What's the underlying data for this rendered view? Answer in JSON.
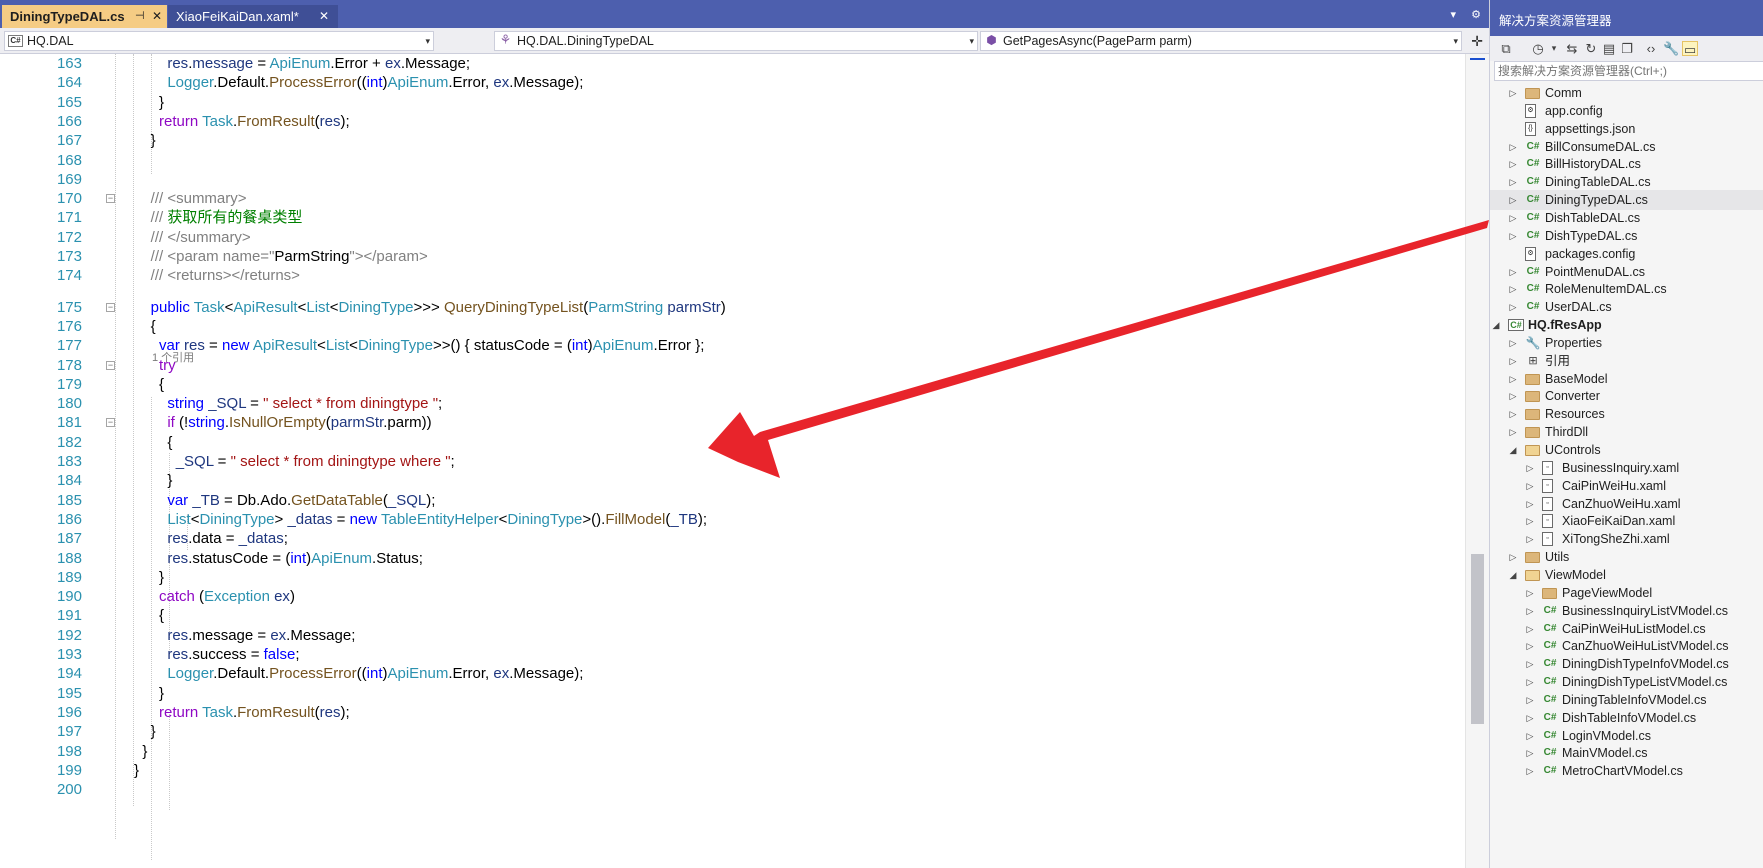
{
  "tabs": [
    {
      "label": "DiningTypeDAL.cs",
      "pin": "⊣",
      "close": "✕",
      "active": true
    },
    {
      "label": "XiaoFeiKaiDan.xaml*",
      "close": "✕",
      "active": false
    }
  ],
  "tabbar_controls": "▾ ⚙",
  "navbar": {
    "project": "HQ.DAL",
    "project_icon": "C#",
    "type": "HQ.DAL.DiningTypeDAL",
    "member": "GetPagesAsync(PageParm parm)",
    "arrow": "▾",
    "split": "✛"
  },
  "editor": {
    "codelens": "1 个引用",
    "lines": [
      {
        "n": "163",
        "tokens": [
          [
            "pl",
            "        "
          ],
          [
            "var",
            "res"
          ],
          [
            "pl",
            "."
          ],
          [
            "var",
            "message"
          ],
          [
            "pl",
            " = "
          ],
          [
            "ty",
            "ApiEnum"
          ],
          [
            "pl",
            ".Error + "
          ],
          [
            "var",
            "ex"
          ],
          [
            "pl",
            ".Message;"
          ]
        ]
      },
      {
        "n": "164",
        "tokens": [
          [
            "pl",
            "        "
          ],
          [
            "ty",
            "Logger"
          ],
          [
            "pl",
            ".Default."
          ],
          [
            "fn",
            "ProcessError"
          ],
          [
            "pl",
            "(("
          ],
          [
            "kw",
            "int"
          ],
          [
            "pl",
            ")"
          ],
          [
            "ty",
            "ApiEnum"
          ],
          [
            "pl",
            ".Error, "
          ],
          [
            "var",
            "ex"
          ],
          [
            "pl",
            ".Message);"
          ]
        ]
      },
      {
        "n": "165",
        "tokens": [
          [
            "pl",
            "      }"
          ]
        ]
      },
      {
        "n": "166",
        "tokens": [
          [
            "pl",
            "      "
          ],
          [
            "ctl",
            "return"
          ],
          [
            "pl",
            " "
          ],
          [
            "ty",
            "Task"
          ],
          [
            "pl",
            "."
          ],
          [
            "fn",
            "FromResult"
          ],
          [
            "pl",
            "("
          ],
          [
            "var",
            "res"
          ],
          [
            "pl",
            ");"
          ]
        ]
      },
      {
        "n": "167",
        "tokens": [
          [
            "pl",
            "    }"
          ]
        ]
      },
      {
        "n": "168",
        "tokens": []
      },
      {
        "n": "169",
        "tokens": []
      },
      {
        "n": "170",
        "tokens": [
          [
            "doc",
            "    /// <summary>"
          ]
        ]
      },
      {
        "n": "171",
        "tokens": [
          [
            "doc",
            "    /// "
          ],
          [
            "cm",
            "获取所有的餐桌类型"
          ]
        ]
      },
      {
        "n": "172",
        "tokens": [
          [
            "doc",
            "    /// </summary>"
          ]
        ]
      },
      {
        "n": "173",
        "tokens": [
          [
            "doc",
            "    /// <param name=\""
          ],
          [
            "pl",
            "ParmString"
          ],
          [
            "doc",
            "\"></param>"
          ]
        ]
      },
      {
        "n": "174",
        "tokens": [
          [
            "doc",
            "    /// <returns></returns>"
          ]
        ]
      },
      {
        "n": "175",
        "tokens": [
          [
            "pl",
            "    "
          ],
          [
            "kw",
            "public"
          ],
          [
            "pl",
            " "
          ],
          [
            "ty",
            "Task"
          ],
          [
            "pl",
            "<"
          ],
          [
            "ty",
            "ApiResult"
          ],
          [
            "pl",
            "<"
          ],
          [
            "ty",
            "List"
          ],
          [
            "pl",
            "<"
          ],
          [
            "ty",
            "DiningType"
          ],
          [
            "pl",
            ">>> "
          ],
          [
            "fn",
            "QueryDiningTypeList"
          ],
          [
            "pl",
            "("
          ],
          [
            "ty",
            "ParmString"
          ],
          [
            "pl",
            " "
          ],
          [
            "var",
            "parmStr"
          ],
          [
            "pl",
            ")"
          ]
        ]
      },
      {
        "n": "176",
        "tokens": [
          [
            "pl",
            "    {"
          ]
        ]
      },
      {
        "n": "177",
        "tokens": [
          [
            "pl",
            "      "
          ],
          [
            "kw",
            "var"
          ],
          [
            "pl",
            " "
          ],
          [
            "var",
            "res"
          ],
          [
            "pl",
            " = "
          ],
          [
            "kw",
            "new"
          ],
          [
            "pl",
            " "
          ],
          [
            "ty",
            "ApiResult"
          ],
          [
            "pl",
            "<"
          ],
          [
            "ty",
            "List"
          ],
          [
            "pl",
            "<"
          ],
          [
            "ty",
            "DiningType"
          ],
          [
            "pl",
            ">>() { statusCode = ("
          ],
          [
            "kw",
            "int"
          ],
          [
            "pl",
            ")"
          ],
          [
            "ty",
            "ApiEnum"
          ],
          [
            "pl",
            ".Error };"
          ]
        ]
      },
      {
        "n": "178",
        "tokens": [
          [
            "pl",
            "      "
          ],
          [
            "ctl",
            "try"
          ]
        ]
      },
      {
        "n": "179",
        "tokens": [
          [
            "pl",
            "      {"
          ]
        ]
      },
      {
        "n": "180",
        "tokens": [
          [
            "pl",
            "        "
          ],
          [
            "kw",
            "string"
          ],
          [
            "pl",
            " "
          ],
          [
            "var",
            "_SQL"
          ],
          [
            "pl",
            " = "
          ],
          [
            "str",
            "\" select * from diningtype \""
          ],
          [
            "pl",
            ";"
          ]
        ]
      },
      {
        "n": "181",
        "tokens": [
          [
            "pl",
            "        "
          ],
          [
            "ctl",
            "if"
          ],
          [
            "pl",
            " (!"
          ],
          [
            "kw",
            "string"
          ],
          [
            "pl",
            "."
          ],
          [
            "fn",
            "IsNullOrEmpty"
          ],
          [
            "pl",
            "("
          ],
          [
            "var",
            "parmStr"
          ],
          [
            "pl",
            ".parm))"
          ]
        ]
      },
      {
        "n": "182",
        "tokens": [
          [
            "pl",
            "        {"
          ]
        ]
      },
      {
        "n": "183",
        "tokens": [
          [
            "pl",
            "          "
          ],
          [
            "var",
            "_SQL"
          ],
          [
            "pl",
            " = "
          ],
          [
            "str",
            "\" select * from diningtype where \""
          ],
          [
            "pl",
            ";"
          ]
        ]
      },
      {
        "n": "184",
        "tokens": [
          [
            "pl",
            "        }"
          ]
        ]
      },
      {
        "n": "185",
        "tokens": [
          [
            "pl",
            "        "
          ],
          [
            "kw",
            "var"
          ],
          [
            "pl",
            " "
          ],
          [
            "var",
            "_TB"
          ],
          [
            "pl",
            " = Db.Ado."
          ],
          [
            "fn",
            "GetDataTable"
          ],
          [
            "pl",
            "("
          ],
          [
            "var",
            "_SQL"
          ],
          [
            "pl",
            ");"
          ]
        ]
      },
      {
        "n": "186",
        "tokens": [
          [
            "pl",
            "        "
          ],
          [
            "ty",
            "List"
          ],
          [
            "pl",
            "<"
          ],
          [
            "ty",
            "DiningType"
          ],
          [
            "pl",
            "> "
          ],
          [
            "var",
            "_datas"
          ],
          [
            "pl",
            " = "
          ],
          [
            "kw",
            "new"
          ],
          [
            "pl",
            " "
          ],
          [
            "ty",
            "TableEntityHelper"
          ],
          [
            "pl",
            "<"
          ],
          [
            "ty",
            "DiningType"
          ],
          [
            "pl",
            ">()."
          ],
          [
            "fn",
            "FillModel"
          ],
          [
            "pl",
            "("
          ],
          [
            "var",
            "_TB"
          ],
          [
            "pl",
            ");"
          ]
        ]
      },
      {
        "n": "187",
        "tokens": [
          [
            "pl",
            "        "
          ],
          [
            "var",
            "res"
          ],
          [
            "pl",
            ".data = "
          ],
          [
            "var",
            "_datas"
          ],
          [
            "pl",
            ";"
          ]
        ]
      },
      {
        "n": "188",
        "tokens": [
          [
            "pl",
            "        "
          ],
          [
            "var",
            "res"
          ],
          [
            "pl",
            ".statusCode = ("
          ],
          [
            "kw",
            "int"
          ],
          [
            "pl",
            ")"
          ],
          [
            "ty",
            "ApiEnum"
          ],
          [
            "pl",
            ".Status;"
          ]
        ]
      },
      {
        "n": "189",
        "tokens": [
          [
            "pl",
            "      }"
          ]
        ]
      },
      {
        "n": "190",
        "tokens": [
          [
            "pl",
            "      "
          ],
          [
            "ctl",
            "catch"
          ],
          [
            "pl",
            " ("
          ],
          [
            "ty",
            "Exception"
          ],
          [
            "pl",
            " "
          ],
          [
            "var",
            "ex"
          ],
          [
            "pl",
            ")"
          ]
        ]
      },
      {
        "n": "191",
        "tokens": [
          [
            "pl",
            "      {"
          ]
        ]
      },
      {
        "n": "192",
        "tokens": [
          [
            "pl",
            "        "
          ],
          [
            "var",
            "res"
          ],
          [
            "pl",
            ".message = "
          ],
          [
            "var",
            "ex"
          ],
          [
            "pl",
            ".Message;"
          ]
        ]
      },
      {
        "n": "193",
        "tokens": [
          [
            "pl",
            "        "
          ],
          [
            "var",
            "res"
          ],
          [
            "pl",
            ".success = "
          ],
          [
            "kw",
            "false"
          ],
          [
            "pl",
            ";"
          ]
        ]
      },
      {
        "n": "194",
        "tokens": [
          [
            "pl",
            "        "
          ],
          [
            "ty",
            "Logger"
          ],
          [
            "pl",
            ".Default."
          ],
          [
            "fn",
            "ProcessError"
          ],
          [
            "pl",
            "(("
          ],
          [
            "kw",
            "int"
          ],
          [
            "pl",
            ")"
          ],
          [
            "ty",
            "ApiEnum"
          ],
          [
            "pl",
            ".Error, "
          ],
          [
            "var",
            "ex"
          ],
          [
            "pl",
            ".Message);"
          ]
        ]
      },
      {
        "n": "195",
        "tokens": [
          [
            "pl",
            "      }"
          ]
        ]
      },
      {
        "n": "196",
        "tokens": [
          [
            "pl",
            "      "
          ],
          [
            "ctl",
            "return"
          ],
          [
            "pl",
            " "
          ],
          [
            "ty",
            "Task"
          ],
          [
            "pl",
            "."
          ],
          [
            "fn",
            "FromResult"
          ],
          [
            "pl",
            "("
          ],
          [
            "var",
            "res"
          ],
          [
            "pl",
            ");"
          ]
        ]
      },
      {
        "n": "197",
        "tokens": [
          [
            "pl",
            "    }"
          ]
        ]
      },
      {
        "n": "198",
        "tokens": [
          [
            "pl",
            "  }"
          ]
        ]
      },
      {
        "n": "199",
        "tokens": [
          [
            "pl",
            "}"
          ]
        ]
      },
      {
        "n": "200",
        "tokens": []
      }
    ]
  },
  "solution_explorer": {
    "title": "解决方案资源管理器",
    "search_placeholder": "搜索解决方案资源管理器(Ctrl+;)",
    "items": [
      {
        "label": "Comm",
        "icon": "folder",
        "expander": "closed"
      },
      {
        "label": "app.config",
        "icon": "config",
        "expander": "none"
      },
      {
        "label": "appsettings.json",
        "icon": "json",
        "expander": "none"
      },
      {
        "label": "BillConsumeDAL.cs",
        "icon": "cs",
        "expander": "closed"
      },
      {
        "label": "BillHistoryDAL.cs",
        "icon": "cs",
        "expander": "closed"
      },
      {
        "label": "DiningTableDAL.cs",
        "icon": "cs",
        "expander": "closed"
      },
      {
        "label": "DiningTypeDAL.cs",
        "icon": "cs",
        "expander": "closed",
        "selected": true
      },
      {
        "label": "DishTableDAL.cs",
        "icon": "cs",
        "expander": "closed"
      },
      {
        "label": "DishTypeDAL.cs",
        "icon": "cs",
        "expander": "closed"
      },
      {
        "label": "packages.config",
        "icon": "config",
        "expander": "none"
      },
      {
        "label": "PointMenuDAL.cs",
        "icon": "cs",
        "expander": "closed"
      },
      {
        "label": "RoleMenuItemDAL.cs",
        "icon": "cs",
        "expander": "closed"
      },
      {
        "label": "UserDAL.cs",
        "icon": "cs",
        "expander": "closed"
      },
      {
        "label": "HQ.fResApp",
        "icon": "project",
        "expander": "open",
        "level": 0,
        "bold": true
      },
      {
        "label": "Properties",
        "icon": "wrench",
        "expander": "closed"
      },
      {
        "label": "引用",
        "icon": "ref",
        "expander": "closed"
      },
      {
        "label": "BaseModel",
        "icon": "folder",
        "expander": "closed"
      },
      {
        "label": "Converter",
        "icon": "folder",
        "expander": "closed"
      },
      {
        "label": "Resources",
        "icon": "folder",
        "expander": "closed"
      },
      {
        "label": "ThirdDll",
        "icon": "folder",
        "expander": "closed"
      },
      {
        "label": "UControls",
        "icon": "folder-open",
        "expander": "open"
      },
      {
        "label": "BusinessInquiry.xaml",
        "icon": "xaml",
        "expander": "closed",
        "level": 2
      },
      {
        "label": "CaiPinWeiHu.xaml",
        "icon": "xaml",
        "expander": "closed",
        "level": 2
      },
      {
        "label": "CanZhuoWeiHu.xaml",
        "icon": "xaml",
        "expander": "closed",
        "level": 2
      },
      {
        "label": "XiaoFeiKaiDan.xaml",
        "icon": "xaml",
        "expander": "closed",
        "level": 2
      },
      {
        "label": "XiTongSheZhi.xaml",
        "icon": "xaml",
        "expander": "closed",
        "level": 2
      },
      {
        "label": "Utils",
        "icon": "folder",
        "expander": "closed"
      },
      {
        "label": "ViewModel",
        "icon": "folder-open",
        "expander": "open"
      },
      {
        "label": "PageViewModel",
        "icon": "folder",
        "expander": "closed",
        "level": 2
      },
      {
        "label": "BusinessInquiryListVModel.cs",
        "icon": "cs",
        "expander": "closed",
        "level": 2
      },
      {
        "label": "CaiPinWeiHuListModel.cs",
        "icon": "cs",
        "expander": "closed",
        "level": 2
      },
      {
        "label": "CanZhuoWeiHuListVModel.cs",
        "icon": "cs",
        "expander": "closed",
        "level": 2
      },
      {
        "label": "DiningDishTypeInfoVModel.cs",
        "icon": "cs",
        "expander": "closed",
        "level": 2
      },
      {
        "label": "DiningDishTypeListVModel.cs",
        "icon": "cs",
        "expander": "closed",
        "level": 2
      },
      {
        "label": "DiningTableInfoVModel.cs",
        "icon": "cs",
        "expander": "closed",
        "level": 2
      },
      {
        "label": "DishTableInfoVModel.cs",
        "icon": "cs",
        "expander": "closed",
        "level": 2
      },
      {
        "label": "LoginVModel.cs",
        "icon": "cs",
        "expander": "closed",
        "level": 2
      },
      {
        "label": "MainVModel.cs",
        "icon": "cs",
        "expander": "closed",
        "level": 2
      },
      {
        "label": "MetroChartVModel.cs",
        "icon": "cs",
        "expander": "closed",
        "level": 2
      }
    ]
  },
  "colors": {
    "title_bar": "#4d5fae",
    "active_tab": "#f5cc84",
    "arrow": "#e8242b",
    "line_number": "#2b91af"
  }
}
